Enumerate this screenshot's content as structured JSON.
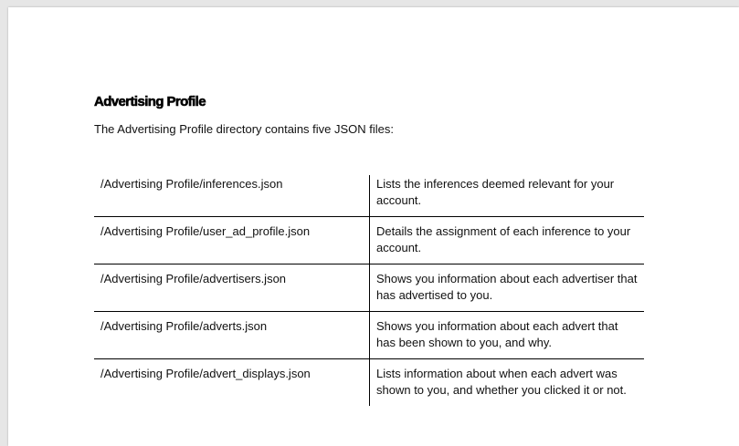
{
  "document": {
    "heading": "Advertising Profile",
    "intro": "The Advertising Profile directory contains five JSON files:",
    "files": [
      {
        "path": "/Advertising Profile/inferences.json",
        "description": "Lists the inferences deemed relevant for your account."
      },
      {
        "path": "/Advertising Profile/user_ad_profile.json",
        "description": "Details the assignment of each inference to your account."
      },
      {
        "path": "/Advertising Profile/advertisers.json",
        "description": "Shows you information about each advertiser that has advertised to you."
      },
      {
        "path": "/Advertising Profile/adverts.json",
        "description": "Shows you information about each advert that has been shown to you, and why."
      },
      {
        "path": "/Advertising Profile/advert_displays.json",
        "description": "Lists information about when each advert was shown to you, and whether you clicked it or not."
      }
    ]
  }
}
